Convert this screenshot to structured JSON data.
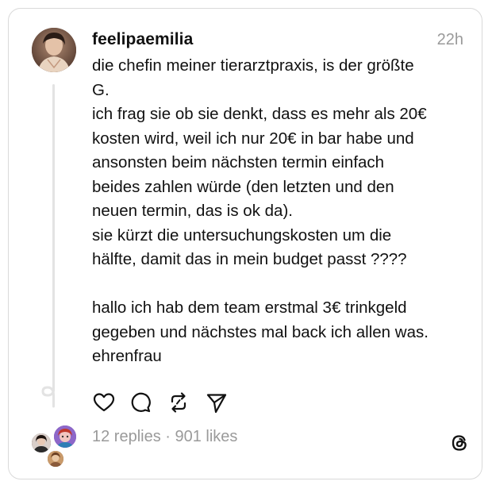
{
  "post": {
    "username": "feelipaemilia",
    "timestamp": "22h",
    "lines": [
      "die chefin meiner tierarztpraxis, is der größte",
      "G.",
      "ich frag sie ob sie denkt, dass es mehr als 20€",
      "kosten wird, weil ich nur 20€ in bar habe und",
      "ansonsten beim nächsten termin einfach",
      "beides zahlen würde (den letzten und den",
      "neuen termin, das is ok da).",
      "sie kürzt die untersuchungskosten um die",
      "hälfte, damit das in mein budget passt ????",
      "",
      "hallo ich hab dem team erstmal 3€ trinkgeld",
      "gegeben und nächstes mal back ich allen was.",
      "ehrenfrau"
    ]
  },
  "actions": [
    {
      "name": "like-button",
      "icon": "heart-icon"
    },
    {
      "name": "comment-button",
      "icon": "comment-icon"
    },
    {
      "name": "repost-button",
      "icon": "repost-icon"
    },
    {
      "name": "share-button",
      "icon": "send-icon"
    }
  ],
  "stats": {
    "text": "12 replies · 901 likes"
  },
  "colors": {
    "text": "#111111",
    "muted": "#9a9a9a",
    "border": "#d9d9d9",
    "thread_line": "#e3e3e3"
  }
}
